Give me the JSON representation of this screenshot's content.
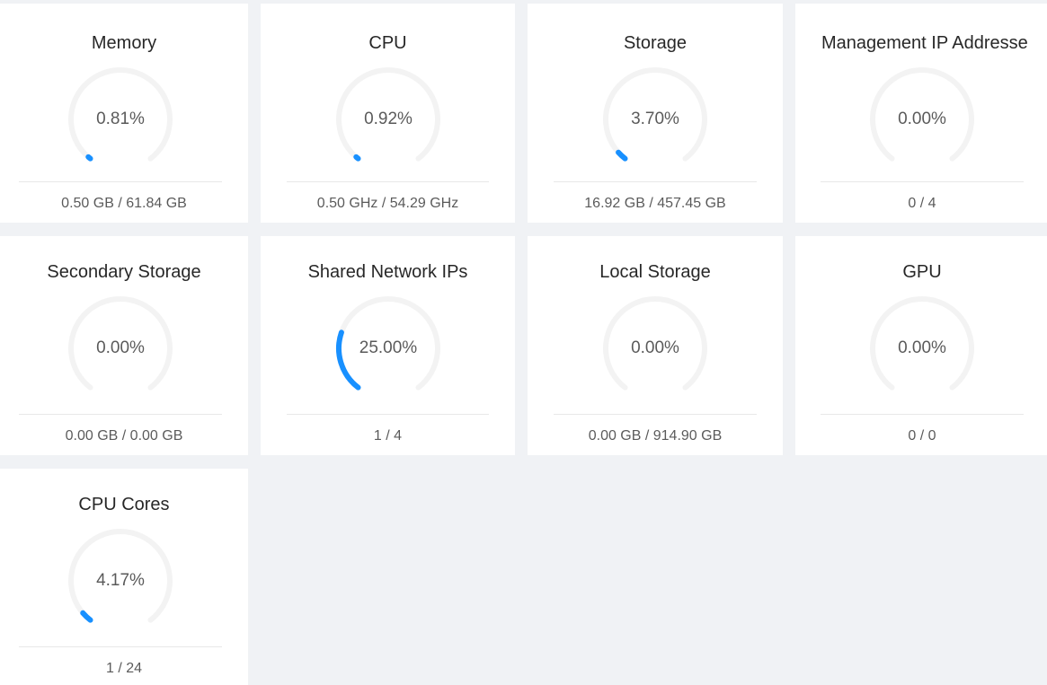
{
  "colors": {
    "trail": "#f3f3f3",
    "stroke": "#1890ff",
    "background": "#f0f2f5"
  },
  "cards": [
    {
      "title": "Memory",
      "percent": 0.81,
      "percent_label": "0.81%",
      "footer": "0.50 GB / 61.84 GB"
    },
    {
      "title": "CPU",
      "percent": 0.92,
      "percent_label": "0.92%",
      "footer": "0.50 GHz / 54.29 GHz"
    },
    {
      "title": "Storage",
      "percent": 3.7,
      "percent_label": "3.70%",
      "footer": "16.92 GB / 457.45 GB"
    },
    {
      "title": "Management IP Addresse",
      "percent": 0.0,
      "percent_label": "0.00%",
      "footer": "0 / 4"
    },
    {
      "title": "Secondary Storage",
      "percent": 0.0,
      "percent_label": "0.00%",
      "footer": "0.00 GB / 0.00 GB"
    },
    {
      "title": "Shared Network IPs",
      "percent": 25.0,
      "percent_label": "25.00%",
      "footer": "1 / 4"
    },
    {
      "title": "Local Storage",
      "percent": 0.0,
      "percent_label": "0.00%",
      "footer": "0.00 GB / 914.90 GB"
    },
    {
      "title": "GPU",
      "percent": 0.0,
      "percent_label": "0.00%",
      "footer": "0 / 0"
    },
    {
      "title": "CPU Cores",
      "percent": 4.17,
      "percent_label": "4.17%",
      "footer": "1 / 24"
    }
  ]
}
